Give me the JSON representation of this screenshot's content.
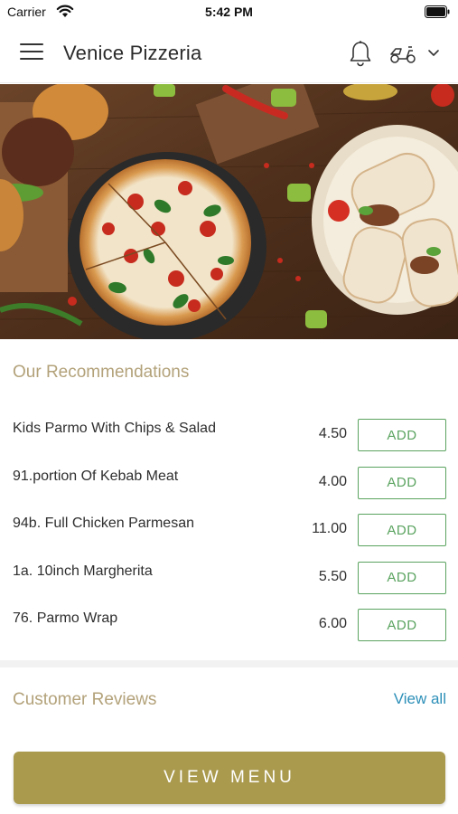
{
  "status_bar": {
    "carrier": "Carrier",
    "time": "5:42 PM",
    "wifi_icon": "wifi-icon",
    "battery_icon": "battery-full-icon"
  },
  "header": {
    "title": "Venice Pizzeria",
    "menu_icon": "hamburger-menu-icon",
    "notification_icon": "bell-icon",
    "delivery_icon": "scooter-icon",
    "dropdown_icon": "chevron-down-icon"
  },
  "hero": {
    "image": "food banner with burgers, pizza and wraps on wooden table"
  },
  "recommendations": {
    "title": "Our Recommendations",
    "items": [
      {
        "name": "Kids Parmo With Chips & Salad",
        "price": "4.50",
        "button": "ADD"
      },
      {
        "name": "91.portion Of Kebab Meat",
        "price": "4.00",
        "button": "ADD"
      },
      {
        "name": "94b. Full Chicken Parmesan",
        "price": "11.00",
        "button": "ADD"
      },
      {
        "name": "1a. 10inch Margherita",
        "price": "5.50",
        "button": "ADD"
      },
      {
        "name": "76. Parmo Wrap",
        "price": "6.00",
        "button": "ADD"
      }
    ]
  },
  "reviews": {
    "title": "Customer Reviews",
    "view_all": "View all"
  },
  "footer": {
    "view_menu": "VIEW MENU"
  },
  "colors": {
    "accent_gold": "#aa9a4e",
    "section_title": "#b3a27a",
    "add_green": "#5aa35f",
    "link_blue": "#2c8fb8"
  }
}
